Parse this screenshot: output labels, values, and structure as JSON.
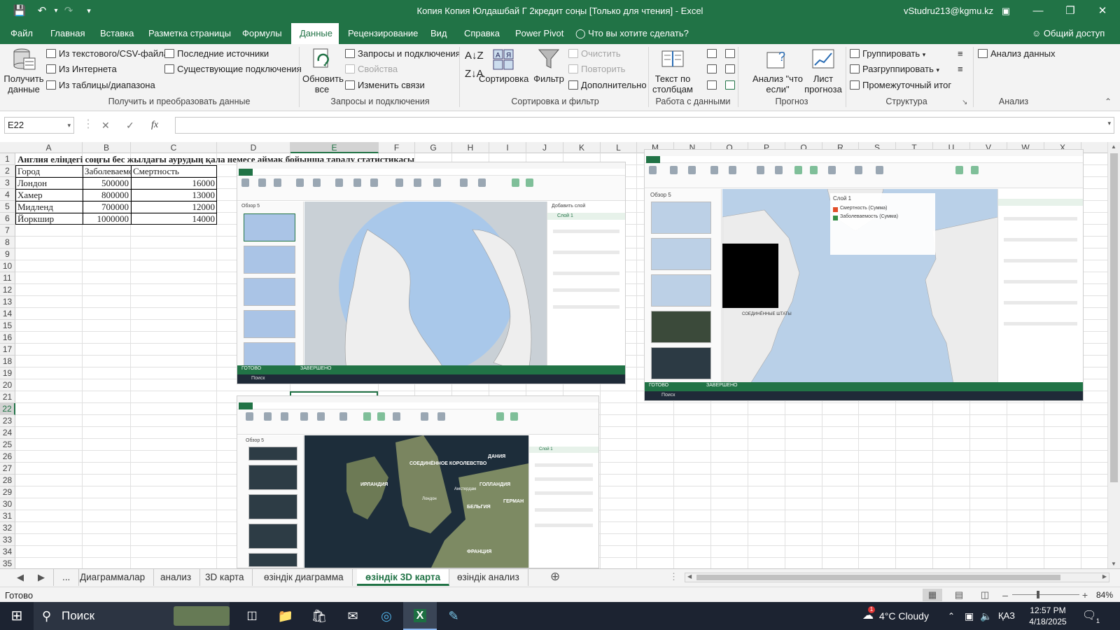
{
  "titlebar": {
    "title": "Копия Копия Юлдашбай Г 2кредит соңы  [Только для чтения]  -  Excel",
    "user": "vStudru213@kgmu.kz",
    "icons": [
      "save-icon",
      "undo-icon",
      "redo-icon",
      "customize-icon",
      "ribbon-display-icon",
      "minimize-icon",
      "restore-icon",
      "close-icon"
    ]
  },
  "tabs": {
    "items": [
      "Файл",
      "Главная",
      "Вставка",
      "Разметка страницы",
      "Формулы",
      "Данные",
      "Рецензирование",
      "Вид",
      "Справка",
      "Power Pivot"
    ],
    "active": "Данные",
    "tell_me": "Что вы хотите сделать?",
    "share": "Общий доступ"
  },
  "ribbon": {
    "get_data": {
      "big_button": "Получить\nданные",
      "from_text": "Из текстового/CSV-файла",
      "from_web": "Из Интернета",
      "from_table": "Из таблицы/диапазона",
      "recent": "Последние источники",
      "existing": "Существующие подключения",
      "label": "Получить и преобразовать данные"
    },
    "queries": {
      "refresh": "Обновить\nвсе",
      "queries": "Запросы и подключения",
      "properties": "Свойства",
      "edit_links": "Изменить связи",
      "label": "Запросы и подключения"
    },
    "sort_filter": {
      "sort": "Сортировка",
      "filter": "Фильтр",
      "clear": "Очистить",
      "reapply": "Повторить",
      "advanced": "Дополнительно",
      "label": "Сортировка и фильтр"
    },
    "data_tools": {
      "text_to_columns": "Текст по\nстолбцам",
      "label": "Работа с данными"
    },
    "forecast": {
      "what_if": "Анализ \"что\nесли\"",
      "forecast_sheet": "Лист\nпрогноза",
      "label": "Прогноз"
    },
    "outline": {
      "group": "Группировать",
      "ungroup": "Разгруппировать",
      "subtotal": "Промежуточный итог",
      "label": "Структура"
    },
    "analysis": {
      "data_analysis": "Анализ данных",
      "label": "Анализ"
    }
  },
  "formula_bar": {
    "name_box": "E22",
    "formula": ""
  },
  "grid": {
    "columns": [
      "A",
      "B",
      "C",
      "D",
      "E",
      "F",
      "G",
      "H",
      "I",
      "J",
      "K",
      "L",
      "M",
      "N",
      "O",
      "P",
      "Q",
      "R",
      "S",
      "T",
      "U",
      "V",
      "W",
      "X"
    ],
    "rows": [
      "1",
      "2",
      "3",
      "4",
      "5",
      "6",
      "7",
      "8",
      "9",
      "10",
      "11",
      "12",
      "13",
      "14",
      "15",
      "16",
      "17",
      "18",
      "19",
      "20",
      "21",
      "22",
      "23",
      "24",
      "25",
      "26",
      "27",
      "28",
      "29",
      "30",
      "31",
      "32",
      "33",
      "34",
      "35"
    ],
    "selected_cell": "E22",
    "title_cell": "Англия еліндегі соңғы бес жылдағы аурудың қала немесе аймақ бойынша таралу статистикасы",
    "table": {
      "headers": [
        "Город",
        "Заболеваемость",
        "Смертность"
      ],
      "rows": [
        [
          "Лондон",
          "500000",
          "16000"
        ],
        [
          "Хамер",
          "800000",
          "13000"
        ],
        [
          "Мидленд",
          "700000",
          "12000"
        ],
        [
          "Йоркшир",
          "1000000",
          "14000"
        ]
      ]
    }
  },
  "embedded_shots": {
    "shot1": {
      "tour": "Обзор 5",
      "add_layer": "Добавить слой",
      "layer": "Слой 1",
      "status": "ГОТОВО",
      "done": "ЗАВЕРШЕНО",
      "search": "Поиск"
    },
    "shot2": {
      "tour": "Обзор 5",
      "legend_title": "Слой 1",
      "legend_items": [
        "Смертность (Сумма)",
        "Заболеваемость (Сумма)"
      ],
      "legend_colors": [
        "#e2461f",
        "#2e8b3e"
      ],
      "map_labels": [
        "СОЕДИНЁННЫЕ ШТАТЫ АМЕРИКИ"
      ],
      "status": "ГОТОВО",
      "done": "ЗАВЕРШЕНО",
      "search": "Поиск"
    },
    "shot3": {
      "tour": "Обзор 5",
      "map_labels": [
        "СОЕДИНЁННОЕ КОРОЛЕВСТВО",
        "ИРЛАНДИЯ",
        "ГОЛЛАНДИЯ",
        "БЕЛЬГИЯ",
        "ДАНИЯ",
        "ФРАНЦИЯ",
        "Лондон",
        "Амстердам",
        "ГЕРМАН"
      ],
      "layer": "Слой 1"
    }
  },
  "sheet_tabs": {
    "items": [
      "Диаграммалар",
      "анализ",
      "3D карта",
      "өзіндік диаграмма",
      "өзіндік 3D карта",
      "өзіндік анализ"
    ],
    "active": "өзіндік 3D карта",
    "ellipsis": "..."
  },
  "statusbar": {
    "status": "Готово",
    "zoom": "84%"
  },
  "taskbar": {
    "search": "Поиск",
    "weather": "4°C  Cloudy",
    "weather_badge": "1",
    "lang": "ҚАЗ",
    "time": "12:57 PM",
    "date": "4/18/2025",
    "notif_count": "1"
  }
}
